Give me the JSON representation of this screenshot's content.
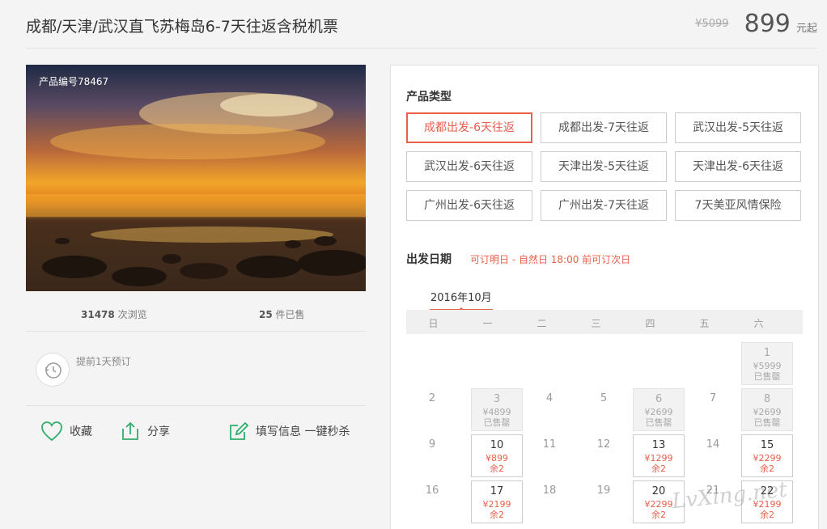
{
  "header": {
    "title": "成都/天津/武汉直飞苏梅岛6-7天往返含税机票",
    "old_price": "¥5099",
    "price": "899",
    "price_unit": "元起"
  },
  "product": {
    "code": "产品编号78467",
    "views_count": "31478",
    "views_label": "次浏览",
    "sold_count": "25",
    "sold_label": "件已售",
    "advance_text": "提前1天预订"
  },
  "actions": {
    "favorite": "收藏",
    "share": "分享",
    "quick_fill": "填写信息 一键秒杀"
  },
  "panel": {
    "type_title": "产品类型",
    "types": [
      "成都出发-6天往返",
      "成都出发-7天往返",
      "武汉出发-5天往返",
      "武汉出发-6天往返",
      "天津出发-5天往返",
      "天津出发-6天往返",
      "广州出发-6天往返",
      "广州出发-7天往返",
      "7天美亚风情保险"
    ],
    "active_type_index": 0,
    "date_title": "出发日期",
    "date_note": "可订明日 - 自然日 18:00 前可订次日",
    "month": "2016年10月",
    "weekdays": [
      "日",
      "一",
      "二",
      "三",
      "四",
      "五",
      "六"
    ]
  },
  "calendar": [
    [
      null,
      null,
      null,
      null,
      null,
      null,
      {
        "d": "1",
        "price": "¥5999",
        "status": "已售罄",
        "state": "soldout"
      }
    ],
    [
      {
        "d": "2",
        "state": "plain"
      },
      {
        "d": "3",
        "price": "¥4899",
        "status": "已售罄",
        "state": "soldout"
      },
      {
        "d": "4",
        "state": "plain"
      },
      {
        "d": "5",
        "state": "plain"
      },
      {
        "d": "6",
        "price": "¥2699",
        "status": "已售罄",
        "state": "soldout"
      },
      {
        "d": "7",
        "state": "plain"
      },
      {
        "d": "8",
        "price": "¥2699",
        "status": "已售罄",
        "state": "soldout"
      }
    ],
    [
      {
        "d": "9",
        "state": "plain"
      },
      {
        "d": "10",
        "price": "¥899",
        "status": "余2",
        "state": "avail"
      },
      {
        "d": "11",
        "state": "plain"
      },
      {
        "d": "12",
        "state": "plain"
      },
      {
        "d": "13",
        "price": "¥1299",
        "status": "余2",
        "state": "avail"
      },
      {
        "d": "14",
        "state": "plain"
      },
      {
        "d": "15",
        "price": "¥2299",
        "status": "余2",
        "state": "avail"
      }
    ],
    [
      {
        "d": "16",
        "state": "plain"
      },
      {
        "d": "17",
        "price": "¥2199",
        "status": "余2",
        "state": "avail"
      },
      {
        "d": "18",
        "state": "plain"
      },
      {
        "d": "19",
        "state": "plain"
      },
      {
        "d": "20",
        "price": "¥2299",
        "status": "余2",
        "state": "avail"
      },
      {
        "d": "21",
        "state": "plain"
      },
      {
        "d": "22",
        "price": "¥2199",
        "status": "余2",
        "state": "avail"
      }
    ]
  ],
  "watermark": "LvXing.net",
  "colors": {
    "accent": "#e8604c",
    "icon_green": "#2fae6b"
  }
}
